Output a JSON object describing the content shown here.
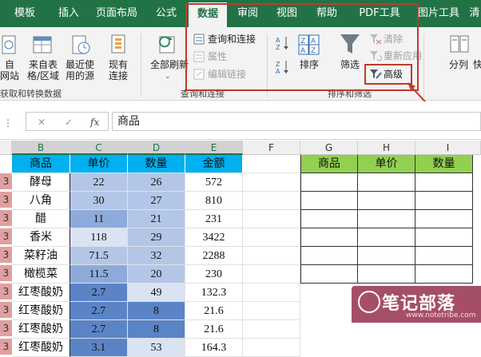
{
  "ribbon_tabs": [
    {
      "label": "模板"
    },
    {
      "label": "插入"
    },
    {
      "label": "页面布局"
    },
    {
      "label": "公式"
    },
    {
      "label": "数据"
    },
    {
      "label": "审阅"
    },
    {
      "label": "视图"
    },
    {
      "label": "帮助"
    },
    {
      "label": "PDF工具"
    },
    {
      "label": "图片工具"
    },
    {
      "label": "清"
    }
  ],
  "get_data": {
    "from_web_l1": "自",
    "from_web_l2": "网站",
    "from_table_l1": "来自表",
    "from_table_l2": "格/区域",
    "recent_l1": "最近使",
    "recent_l2": "用的源",
    "existing_l1": "现有",
    "existing_l2": "连接",
    "group_label": "获取和转换数据"
  },
  "queries": {
    "refresh_all": "全部刷新",
    "queries_connections": "查询和连接",
    "properties": "属性",
    "edit_links": "编辑链接",
    "group_label": "查询和连接"
  },
  "sort_filter": {
    "sort": "排序",
    "filter": "筛选",
    "clear": "清除",
    "reapply": "重新应用",
    "advanced": "高级",
    "group_label": "排序和筛选"
  },
  "data_tools": {
    "split": "分列",
    "next": "快"
  },
  "formula_bar": {
    "cancel_glyph": "✕",
    "enter_glyph": "✓",
    "fx": "fx",
    "content": "商品"
  },
  "columns": [
    "B",
    "C",
    "D",
    "E",
    "F",
    "G",
    "H",
    "I"
  ],
  "rows_left": [
    [
      "商品",
      "单价",
      "数量",
      "金额"
    ],
    [
      "酵母",
      "22",
      "26",
      "572"
    ],
    [
      "八角",
      "30",
      "27",
      "810"
    ],
    [
      "醋",
      "11",
      "21",
      "231"
    ],
    [
      "香米",
      "118",
      "29",
      "3422"
    ],
    [
      "菜籽油",
      "71.5",
      "32",
      "2288"
    ],
    [
      "橄榄菜",
      "11.5",
      "20",
      "230"
    ],
    [
      "红枣酸奶",
      "2.7",
      "49",
      "132.3"
    ],
    [
      "红枣酸奶",
      "2.7",
      "8",
      "21.6"
    ],
    [
      "红枣酸奶",
      "2.7",
      "8",
      "21.6"
    ],
    [
      "红枣酸奶",
      "3.1",
      "53",
      "164.3"
    ]
  ],
  "row_numbers": [
    "",
    "3",
    "3",
    "3",
    "3",
    "3",
    "3",
    "3",
    "3",
    "3",
    "3"
  ],
  "criteria_headers": [
    "商品",
    "单价",
    "数量"
  ],
  "watermark": {
    "title": "笔记部落",
    "sub": "www.notetribe.com"
  },
  "colors": {
    "accent": "#217346",
    "header_blue": "#00b0f0",
    "criteria_green": "#92d050",
    "highlight_red": "#c0392b"
  }
}
